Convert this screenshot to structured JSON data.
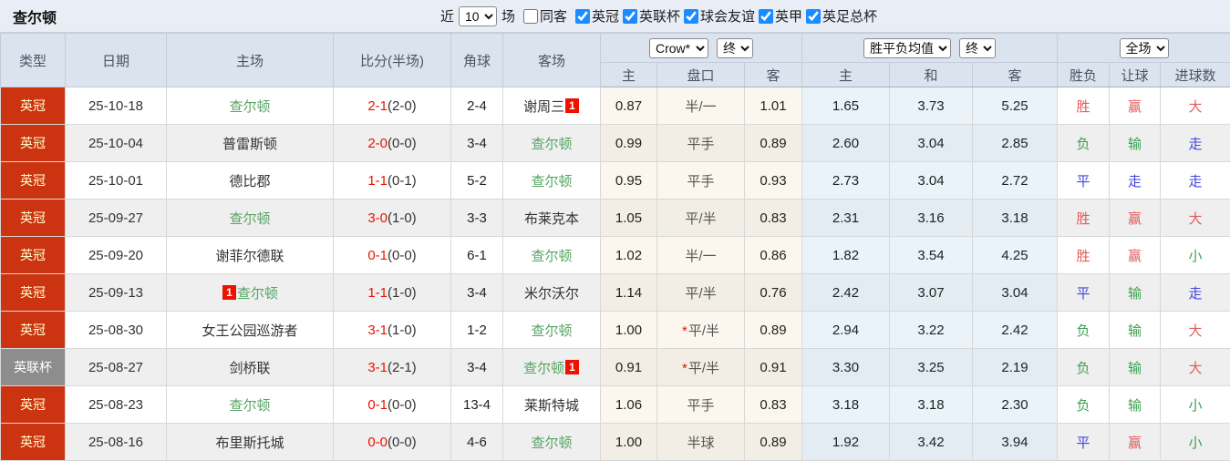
{
  "colors": {
    "league_red": "#cc3310",
    "league_gray": "#8d8d8d",
    "team_green": "#55a463",
    "score_red": "#ee1100",
    "result_red": "#e05c5c",
    "result_green": "#3e9e50",
    "result_blue": "#4444dd",
    "checkbox_blue": "#1b8cff"
  },
  "header": {
    "title": "查尔顿",
    "filter": {
      "recent_label": "近",
      "recent_value": "10",
      "matches_label": "场",
      "same_venue": {
        "label": "同客",
        "checked": false
      },
      "leagues": [
        {
          "label": "英冠",
          "checked": true
        },
        {
          "label": "英联杯",
          "checked": true
        },
        {
          "label": "球会友谊",
          "checked": true
        },
        {
          "label": "英甲",
          "checked": true
        },
        {
          "label": "英足总杯",
          "checked": true
        }
      ]
    }
  },
  "table": {
    "main_headers": [
      "类型",
      "日期",
      "主场",
      "比分(半场)",
      "角球",
      "客场"
    ],
    "selects": {
      "company": "Crow*",
      "time1": "终",
      "avg_mode": "胜平负均值",
      "time2": "终",
      "scope": "全场"
    },
    "sub_headers": [
      "主",
      "盘口",
      "客",
      "主",
      "和",
      "客",
      "胜负",
      "让球",
      "进球数"
    ],
    "rows": [
      {
        "league": {
          "text": "英冠",
          "variant": "red"
        },
        "date": "25-10-18",
        "home": {
          "name": "查尔顿",
          "green": true,
          "badge": null,
          "badge_pos": null
        },
        "score": {
          "ft": "2-1",
          "ht": "(2-0)"
        },
        "corners": "2-4",
        "away": {
          "name": "谢周三",
          "green": false,
          "badge": "1",
          "badge_pos": "after"
        },
        "odds": {
          "home": "0.87",
          "star": false,
          "handicap": "半/一",
          "away": "1.01"
        },
        "avg": [
          "1.65",
          "3.73",
          "5.25"
        ],
        "results": [
          {
            "t": "胜",
            "c": "red"
          },
          {
            "t": "赢",
            "c": "red"
          },
          {
            "t": "大",
            "c": "red"
          }
        ]
      },
      {
        "league": {
          "text": "英冠",
          "variant": "red"
        },
        "date": "25-10-04",
        "home": {
          "name": "普雷斯顿",
          "green": false,
          "badge": null,
          "badge_pos": null
        },
        "score": {
          "ft": "2-0",
          "ht": "(0-0)"
        },
        "corners": "3-4",
        "away": {
          "name": "查尔顿",
          "green": true,
          "badge": null,
          "badge_pos": null
        },
        "odds": {
          "home": "0.99",
          "star": false,
          "handicap": "平手",
          "away": "0.89"
        },
        "avg": [
          "2.60",
          "3.04",
          "2.85"
        ],
        "results": [
          {
            "t": "负",
            "c": "green"
          },
          {
            "t": "输",
            "c": "green"
          },
          {
            "t": "走",
            "c": "blue"
          }
        ]
      },
      {
        "league": {
          "text": "英冠",
          "variant": "red"
        },
        "date": "25-10-01",
        "home": {
          "name": "德比郡",
          "green": false,
          "badge": null,
          "badge_pos": null
        },
        "score": {
          "ft": "1-1",
          "ht": "(0-1)"
        },
        "corners": "5-2",
        "away": {
          "name": "查尔顿",
          "green": true,
          "badge": null,
          "badge_pos": null
        },
        "odds": {
          "home": "0.95",
          "star": false,
          "handicap": "平手",
          "away": "0.93"
        },
        "avg": [
          "2.73",
          "3.04",
          "2.72"
        ],
        "results": [
          {
            "t": "平",
            "c": "blue"
          },
          {
            "t": "走",
            "c": "blue"
          },
          {
            "t": "走",
            "c": "blue"
          }
        ]
      },
      {
        "league": {
          "text": "英冠",
          "variant": "red"
        },
        "date": "25-09-27",
        "home": {
          "name": "查尔顿",
          "green": true,
          "badge": null,
          "badge_pos": null
        },
        "score": {
          "ft": "3-0",
          "ht": "(1-0)"
        },
        "corners": "3-3",
        "away": {
          "name": "布莱克本",
          "green": false,
          "badge": null,
          "badge_pos": null
        },
        "odds": {
          "home": "1.05",
          "star": false,
          "handicap": "平/半",
          "away": "0.83"
        },
        "avg": [
          "2.31",
          "3.16",
          "3.18"
        ],
        "results": [
          {
            "t": "胜",
            "c": "red"
          },
          {
            "t": "赢",
            "c": "red"
          },
          {
            "t": "大",
            "c": "red"
          }
        ]
      },
      {
        "league": {
          "text": "英冠",
          "variant": "red"
        },
        "date": "25-09-20",
        "home": {
          "name": "谢菲尔德联",
          "green": false,
          "badge": null,
          "badge_pos": null
        },
        "score": {
          "ft": "0-1",
          "ht": "(0-0)"
        },
        "corners": "6-1",
        "away": {
          "name": "查尔顿",
          "green": true,
          "badge": null,
          "badge_pos": null
        },
        "odds": {
          "home": "1.02",
          "star": false,
          "handicap": "半/一",
          "away": "0.86"
        },
        "avg": [
          "1.82",
          "3.54",
          "4.25"
        ],
        "results": [
          {
            "t": "胜",
            "c": "red"
          },
          {
            "t": "赢",
            "c": "red"
          },
          {
            "t": "小",
            "c": "green"
          }
        ]
      },
      {
        "league": {
          "text": "英冠",
          "variant": "red"
        },
        "date": "25-09-13",
        "home": {
          "name": "查尔顿",
          "green": true,
          "badge": "1",
          "badge_pos": "before"
        },
        "score": {
          "ft": "1-1",
          "ht": "(1-0)"
        },
        "corners": "3-4",
        "away": {
          "name": "米尔沃尔",
          "green": false,
          "badge": null,
          "badge_pos": null
        },
        "odds": {
          "home": "1.14",
          "star": false,
          "handicap": "平/半",
          "away": "0.76"
        },
        "avg": [
          "2.42",
          "3.07",
          "3.04"
        ],
        "results": [
          {
            "t": "平",
            "c": "blue"
          },
          {
            "t": "输",
            "c": "green"
          },
          {
            "t": "走",
            "c": "blue"
          }
        ]
      },
      {
        "league": {
          "text": "英冠",
          "variant": "red"
        },
        "date": "25-08-30",
        "home": {
          "name": "女王公园巡游者",
          "green": false,
          "badge": null,
          "badge_pos": null
        },
        "score": {
          "ft": "3-1",
          "ht": "(1-0)"
        },
        "corners": "1-2",
        "away": {
          "name": "查尔顿",
          "green": true,
          "badge": null,
          "badge_pos": null
        },
        "odds": {
          "home": "1.00",
          "star": true,
          "handicap": "平/半",
          "away": "0.89"
        },
        "avg": [
          "2.94",
          "3.22",
          "2.42"
        ],
        "results": [
          {
            "t": "负",
            "c": "green"
          },
          {
            "t": "输",
            "c": "green"
          },
          {
            "t": "大",
            "c": "red"
          }
        ]
      },
      {
        "league": {
          "text": "英联杯",
          "variant": "gray"
        },
        "date": "25-08-27",
        "home": {
          "name": "剑桥联",
          "green": false,
          "badge": null,
          "badge_pos": null
        },
        "score": {
          "ft": "3-1",
          "ht": "(2-1)"
        },
        "corners": "3-4",
        "away": {
          "name": "查尔顿",
          "green": true,
          "badge": "1",
          "badge_pos": "after"
        },
        "odds": {
          "home": "0.91",
          "star": true,
          "handicap": "平/半",
          "away": "0.91"
        },
        "avg": [
          "3.30",
          "3.25",
          "2.19"
        ],
        "results": [
          {
            "t": "负",
            "c": "green"
          },
          {
            "t": "输",
            "c": "green"
          },
          {
            "t": "大",
            "c": "red"
          }
        ]
      },
      {
        "league": {
          "text": "英冠",
          "variant": "red"
        },
        "date": "25-08-23",
        "home": {
          "name": "查尔顿",
          "green": true,
          "badge": null,
          "badge_pos": null
        },
        "score": {
          "ft": "0-1",
          "ht": "(0-0)"
        },
        "corners": "13-4",
        "away": {
          "name": "莱斯特城",
          "green": false,
          "badge": null,
          "badge_pos": null
        },
        "odds": {
          "home": "1.06",
          "star": false,
          "handicap": "平手",
          "away": "0.83"
        },
        "avg": [
          "3.18",
          "3.18",
          "2.30"
        ],
        "results": [
          {
            "t": "负",
            "c": "green"
          },
          {
            "t": "输",
            "c": "green"
          },
          {
            "t": "小",
            "c": "green"
          }
        ]
      },
      {
        "league": {
          "text": "英冠",
          "variant": "red"
        },
        "date": "25-08-16",
        "home": {
          "name": "布里斯托城",
          "green": false,
          "badge": null,
          "badge_pos": null
        },
        "score": {
          "ft": "0-0",
          "ht": "(0-0)"
        },
        "corners": "4-6",
        "away": {
          "name": "查尔顿",
          "green": true,
          "badge": null,
          "badge_pos": null
        },
        "odds": {
          "home": "1.00",
          "star": false,
          "handicap": "半球",
          "away": "0.89"
        },
        "avg": [
          "1.92",
          "3.42",
          "3.94"
        ],
        "results": [
          {
            "t": "平",
            "c": "blue"
          },
          {
            "t": "赢",
            "c": "red"
          },
          {
            "t": "小",
            "c": "green"
          }
        ]
      }
    ]
  }
}
